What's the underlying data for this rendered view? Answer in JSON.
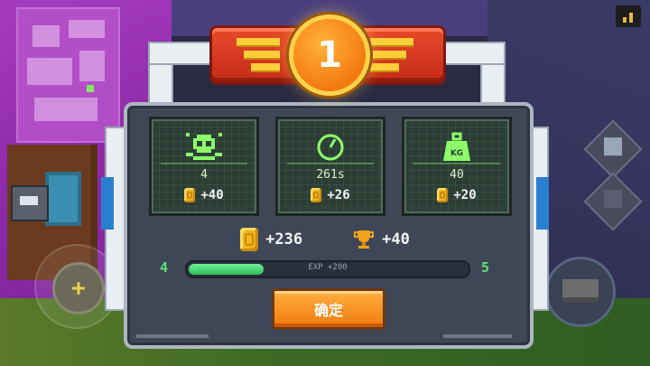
{
  "rank": {
    "position": "1"
  },
  "stats": [
    {
      "name": "kills",
      "icon": "skull-icon",
      "value": "4",
      "reward": "+40"
    },
    {
      "name": "time",
      "icon": "clock-icon",
      "value": "261s",
      "reward": "+26"
    },
    {
      "name": "weight",
      "icon": "kg-weight-icon",
      "value": "40",
      "reward": "+20",
      "icon_label": "KG"
    }
  ],
  "totals": {
    "coins": "+236",
    "trophies": "+40"
  },
  "level": {
    "current": "4",
    "next": "5",
    "exp_text": "EXP +200",
    "exp_progress": 0.27
  },
  "confirm_button": {
    "label": "确定"
  },
  "colors": {
    "accent_green": "#5de07a",
    "coin_gold": "#f0b41e",
    "button_orange": "#f07a0e",
    "banner_red": "#d63a20"
  }
}
